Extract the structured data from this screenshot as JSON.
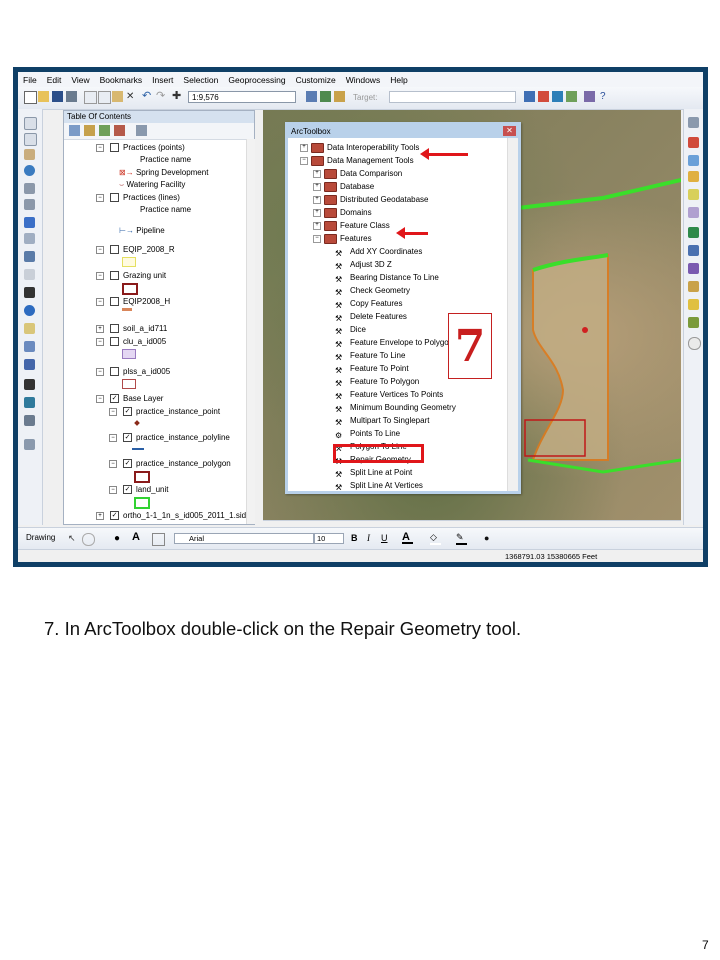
{
  "menu": [
    "File",
    "Edit",
    "View",
    "Bookmarks",
    "Insert",
    "Selection",
    "Geoprocessing",
    "Customize",
    "Windows",
    "Help"
  ],
  "toolbar": {
    "scale": "1:9,576",
    "target_label": "Target:"
  },
  "toc": {
    "title": "Table Of Contents",
    "rows": [
      "Practices (points)",
      "Practice name",
      "Spring Development",
      "Watering Facility",
      "Practices (lines)",
      "Practice name",
      "Pipeline",
      "EQIP_2008_R",
      "Grazing unit",
      "EQIP2008_H",
      "soil_a_id711",
      "clu_a_id005",
      "plss_a_id005",
      "Base Layer",
      "practice_instance_point",
      "practice_instance_polyline",
      "practice_instance_polygon",
      "land_unit",
      "ortho_1-1_1n_s_id005_2011_1.sid"
    ]
  },
  "arctoolbox": {
    "title": "ArcToolbox",
    "items": [
      "Data Interoperability Tools",
      "Data Management Tools",
      "Data Comparison",
      "Database",
      "Distributed Geodatabase",
      "Domains",
      "Feature Class",
      "Features",
      "Add XY Coordinates",
      "Adjust 3D Z",
      "Bearing Distance To Line",
      "Check Geometry",
      "Copy Features",
      "Delete Features",
      "Dice",
      "Feature Envelope to Polygon",
      "Feature To Line",
      "Feature To Point",
      "Feature To Polygon",
      "Feature Vertices To Points",
      "Minimum Bounding Geometry",
      "Multipart To Singlepart",
      "Points To Line",
      "Polygon To Line",
      "Repair Geometry",
      "Split Line at Point",
      "Split Line At Vertices"
    ]
  },
  "drawbar": {
    "drawing_label": "Drawing",
    "font_name": "Arial",
    "font_size": "10",
    "bold": "B",
    "italic": "I",
    "underline": "U"
  },
  "status": {
    "coordinates": "1368791.03  15380665 Feet"
  },
  "callout": {
    "step": "7"
  },
  "caption": "7. In ArcToolbox double-click on the Repair Geometry tool.",
  "page_number": "7",
  "colors": {
    "highlight": "#e0161a",
    "title_bar": "#b9d1ea",
    "frame": "#0f3f66"
  }
}
